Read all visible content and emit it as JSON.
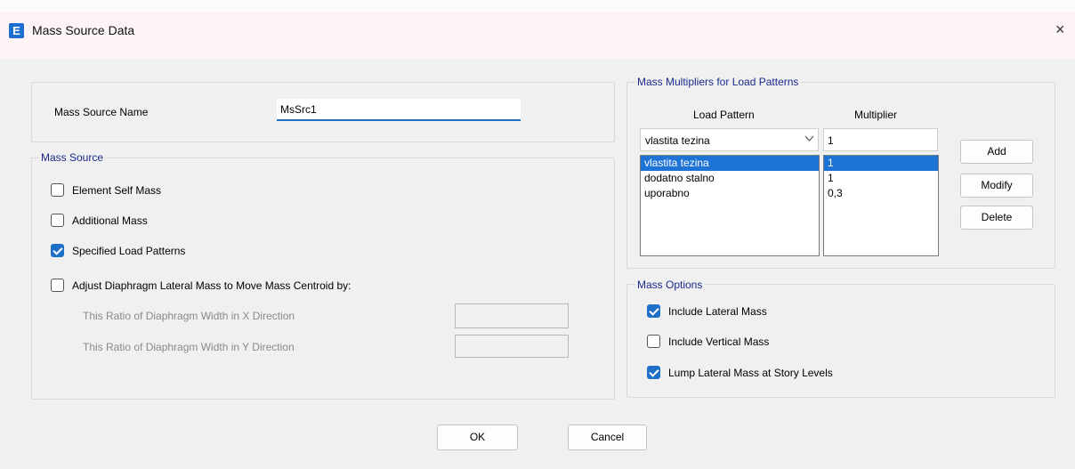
{
  "window": {
    "title": "Mass Source Data",
    "app_icon_letter": "E",
    "close_glyph": "×"
  },
  "name_row": {
    "label": "Mass Source Name",
    "value": "MsSrc1"
  },
  "mass_source": {
    "legend": "Mass Source",
    "options": [
      {
        "label": "Element Self Mass",
        "checked": false
      },
      {
        "label": "Additional Mass",
        "checked": false
      },
      {
        "label": "Specified Load Patterns",
        "checked": true
      },
      {
        "label": "Adjust Diaphragm Lateral Mass to Move Mass Centroid by:",
        "checked": false
      }
    ],
    "ratio_x_label": "This Ratio of Diaphragm Width in X Direction",
    "ratio_y_label": "This Ratio of Diaphragm Width in Y Direction",
    "ratio_x_value": "",
    "ratio_y_value": ""
  },
  "multipliers": {
    "legend": "Mass Multipliers for Load Patterns",
    "col_pattern": "Load Pattern",
    "col_multiplier": "Multiplier",
    "selected_pattern": "vlastita tezina",
    "multiplier_value": "1",
    "rows": [
      {
        "pattern": "vlastita tezina",
        "multiplier": "1"
      },
      {
        "pattern": "dodatno stalno",
        "multiplier": "1"
      },
      {
        "pattern": "uporabno",
        "multiplier": "0,3"
      }
    ],
    "add": "Add",
    "modify": "Modify",
    "delete": "Delete"
  },
  "mass_options": {
    "legend": "Mass Options",
    "options": [
      {
        "label": "Include Lateral Mass",
        "checked": true
      },
      {
        "label": "Include Vertical Mass",
        "checked": false
      },
      {
        "label": "Lump Lateral Mass at Story Levels",
        "checked": true
      }
    ]
  },
  "footer": {
    "ok": "OK",
    "cancel": "Cancel"
  },
  "colors": {
    "accent": "#1e6fc8",
    "legend_text": "#1a2a8c",
    "selection": "#1e73d7"
  }
}
